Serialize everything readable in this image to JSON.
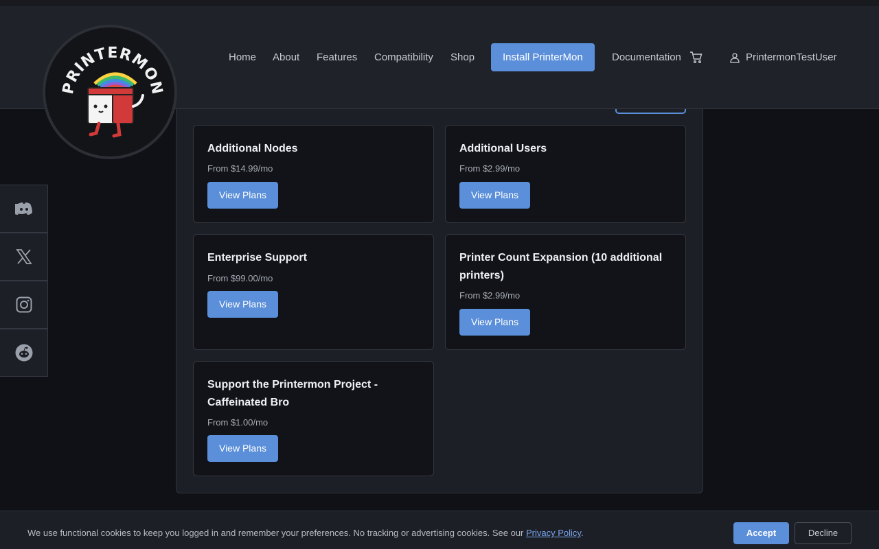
{
  "brand": {
    "logo_text": "PRINTERMON"
  },
  "nav": {
    "home": "Home",
    "about": "About",
    "features": "Features",
    "compatibility": "Compatibility",
    "shop": "Shop",
    "install": "Install PrinterMon",
    "documentation": "Documentation",
    "user": "PrintermonTestUser",
    "icons": {
      "cart": "cart-icon",
      "user": "user-icon"
    }
  },
  "plans": [
    {
      "title": "Additional Nodes",
      "price": "From $14.99/mo",
      "button": "View Plans"
    },
    {
      "title": "Additional Users",
      "price": "From $2.99/mo",
      "button": "View Plans"
    },
    {
      "title": "Enterprise Support",
      "price": "From $99.00/mo",
      "button": "View Plans"
    },
    {
      "title": "Printer Count Expansion (10 additional printers)",
      "price": "From $2.99/mo",
      "button": "View Plans"
    },
    {
      "title": "Support the Printermon Project - Caffeinated Bro",
      "price": "From $1.00/mo",
      "button": "View Plans"
    }
  ],
  "social": [
    "discord-icon",
    "x-icon",
    "instagram-icon",
    "reddit-icon"
  ],
  "cookie": {
    "message": "We use functional cookies to keep you logged in and remember your preferences. No tracking or advertising cookies. See our ",
    "link": "Privacy Policy",
    "suffix": ".",
    "accept": "Accept",
    "decline": "Decline"
  },
  "colors": {
    "accent": "#5b8fd9",
    "background": "#0f1116",
    "header": "#1f2229",
    "card": "#111318"
  }
}
